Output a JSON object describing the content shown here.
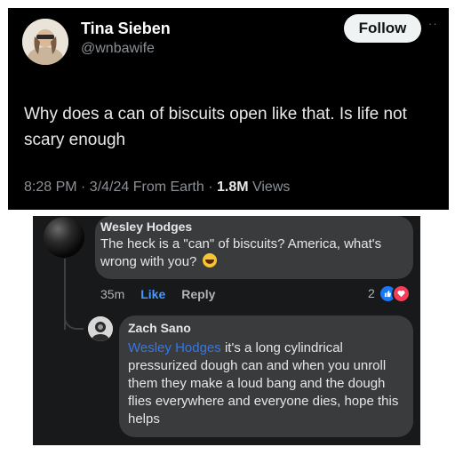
{
  "tweet": {
    "author_name": "Tina Sieben",
    "author_handle": "@wnbawife",
    "follow_label": "Follow",
    "more_label": "··",
    "text": "Why does a can of biscuits open like that. Is life not scary enough",
    "meta_time": "8:28 PM · 3/4/24 From Earth · ",
    "views_count": "1.8M",
    "views_label": " Views"
  },
  "comment": {
    "author_name": "Wesley Hodges",
    "text": "The heck is a \"can\" of biscuits? America, what's wrong with you?",
    "emoji": "grinning-sweat-emoji",
    "time": "35m",
    "like_label": "Like",
    "reply_label": "Reply",
    "reaction_count": "2",
    "reaction_icons": [
      "like-icon",
      "love-icon"
    ]
  },
  "reply": {
    "author_name": "Zach Sano",
    "mention": "Wesley Hodges",
    "text": " it's a long cylindrical pressurized dough can and when you unroll them they make a loud bang and the dough flies everywhere and everyone dies, hope this helps"
  },
  "colors": {
    "tweet_bg": "#000000",
    "fb_bg": "#18191a",
    "bubble": "#3a3b3c",
    "link_blue": "#4599ff",
    "mention_blue": "#3578e5",
    "like_blue": "#1877f2",
    "love_red": "#f33e58"
  }
}
